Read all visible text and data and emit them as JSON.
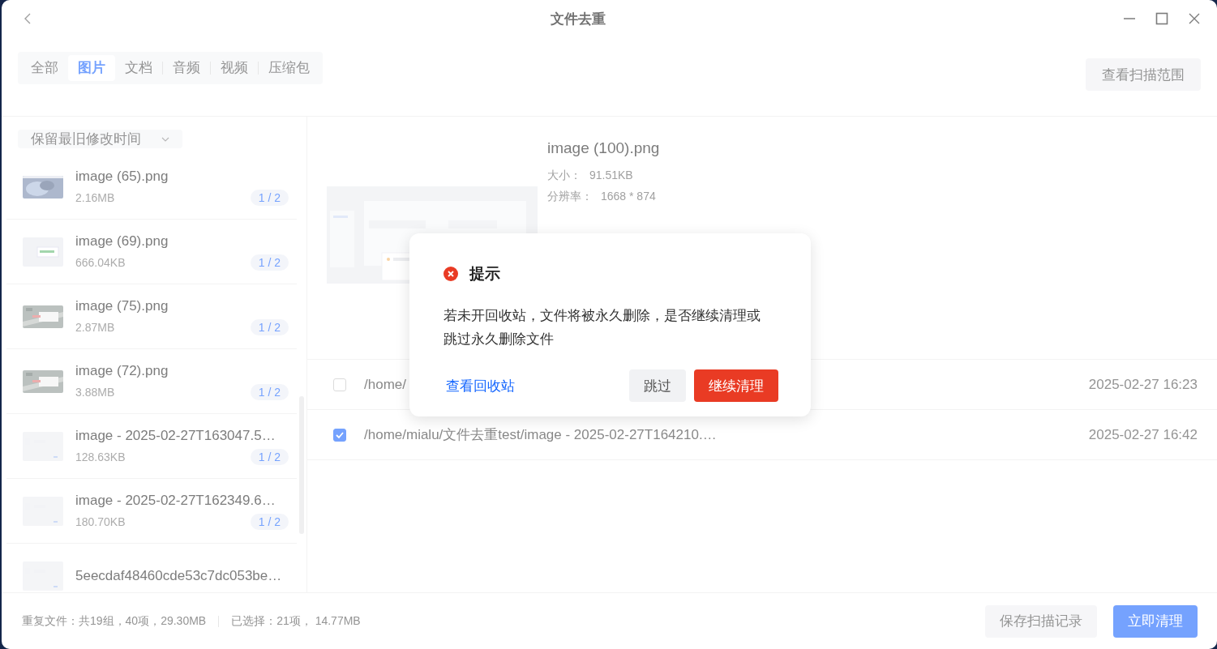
{
  "window": {
    "title": "文件去重"
  },
  "tabs": [
    {
      "label": "全部",
      "selected": false
    },
    {
      "label": "图片",
      "selected": true
    },
    {
      "label": "文档",
      "selected": false
    },
    {
      "label": "音频",
      "selected": false
    },
    {
      "label": "视频",
      "selected": false
    },
    {
      "label": "压缩包",
      "selected": false
    }
  ],
  "scan_scope_button": "查看扫描范围",
  "sort_dropdown": {
    "value": "保留最旧修改时间"
  },
  "file_groups": [
    {
      "name": "image (65).png",
      "size": "2.16MB",
      "count": "1 / 2"
    },
    {
      "name": "image (69).png",
      "size": "666.04KB",
      "count": "1 / 2"
    },
    {
      "name": "image (75).png",
      "size": "2.87MB",
      "count": "1 / 2"
    },
    {
      "name": "image (72).png",
      "size": "3.88MB",
      "count": "1 / 2"
    },
    {
      "name": "image - 2025-02-27T163047.5…",
      "size": "128.63KB",
      "count": "1 / 2"
    },
    {
      "name": "image - 2025-02-27T162349.6…",
      "size": "180.70KB",
      "count": "1 / 2"
    },
    {
      "name": "5eecdaf48460cde53c7dc053be…"
    }
  ],
  "preview": {
    "name": "image (100).png",
    "size_label": "大小：",
    "size": "91.51KB",
    "resolution_label": "分辨率：",
    "resolution": "1668 * 874"
  },
  "files": [
    {
      "path": "/home/",
      "time": "2025-02-27 16:23",
      "checked": false
    },
    {
      "path": "/home/mialu/文件去重test/image - 2025-02-27T164210.…",
      "time": "2025-02-27 16:42",
      "checked": true
    }
  ],
  "status_bar": {
    "total": "重复文件：共19组，40项，29.30MB",
    "selected": "已选择：21项， 14.77MB"
  },
  "footer_buttons": [
    {
      "label": "保存扫描记录",
      "kind": "secondary"
    },
    {
      "label": "立即清理",
      "kind": "primary"
    }
  ],
  "dialog": {
    "title": "提示",
    "message": "若未开回收站，文件将被永久删除，是否继续清理或跳过永久删除文件",
    "link": "查看回收站",
    "buttons": [
      {
        "label": "跳过",
        "kind": "secondary"
      },
      {
        "label": "继续清理",
        "kind": "danger"
      }
    ]
  }
}
